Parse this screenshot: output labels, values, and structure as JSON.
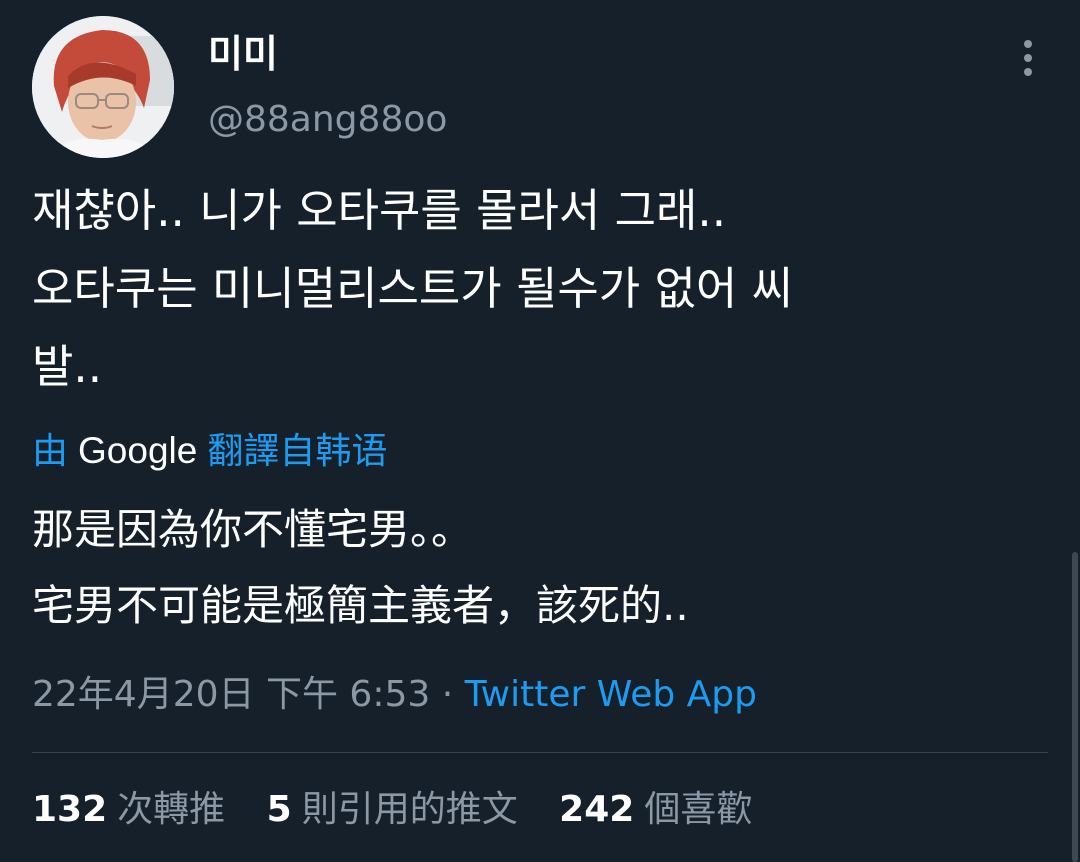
{
  "author": {
    "display_name": "미미",
    "handle": "@88ang88oo",
    "avatar_icon": "user-avatar"
  },
  "more_icon": "more-vertical-icon",
  "tweet": {
    "text_lines": [
      "재챦아.. 니가 오타쿠를 몰라서 그래..",
      "오타쿠는 미니멀리스트가 될수가 없어 씨",
      "발.."
    ]
  },
  "translation": {
    "by": "由",
    "provider": "Google",
    "from_label": "翻譯自韩语",
    "text_lines": [
      "那是因為你不懂宅男。。",
      "宅男不可能是極簡主義者，該死的.."
    ]
  },
  "meta": {
    "timestamp": "22年4月20日 下午 6:53",
    "separator": "·",
    "source": "Twitter Web App"
  },
  "stats": {
    "retweets": {
      "count": "132",
      "label": "次轉推"
    },
    "quotes": {
      "count": "5",
      "label": "則引用的推文"
    },
    "likes": {
      "count": "242",
      "label": "個喜歡"
    }
  },
  "colors": {
    "background": "#15202b",
    "text_primary": "#ffffff",
    "text_secondary": "#8b98a5",
    "link": "#1d9bf0",
    "divider": "#38444d"
  }
}
